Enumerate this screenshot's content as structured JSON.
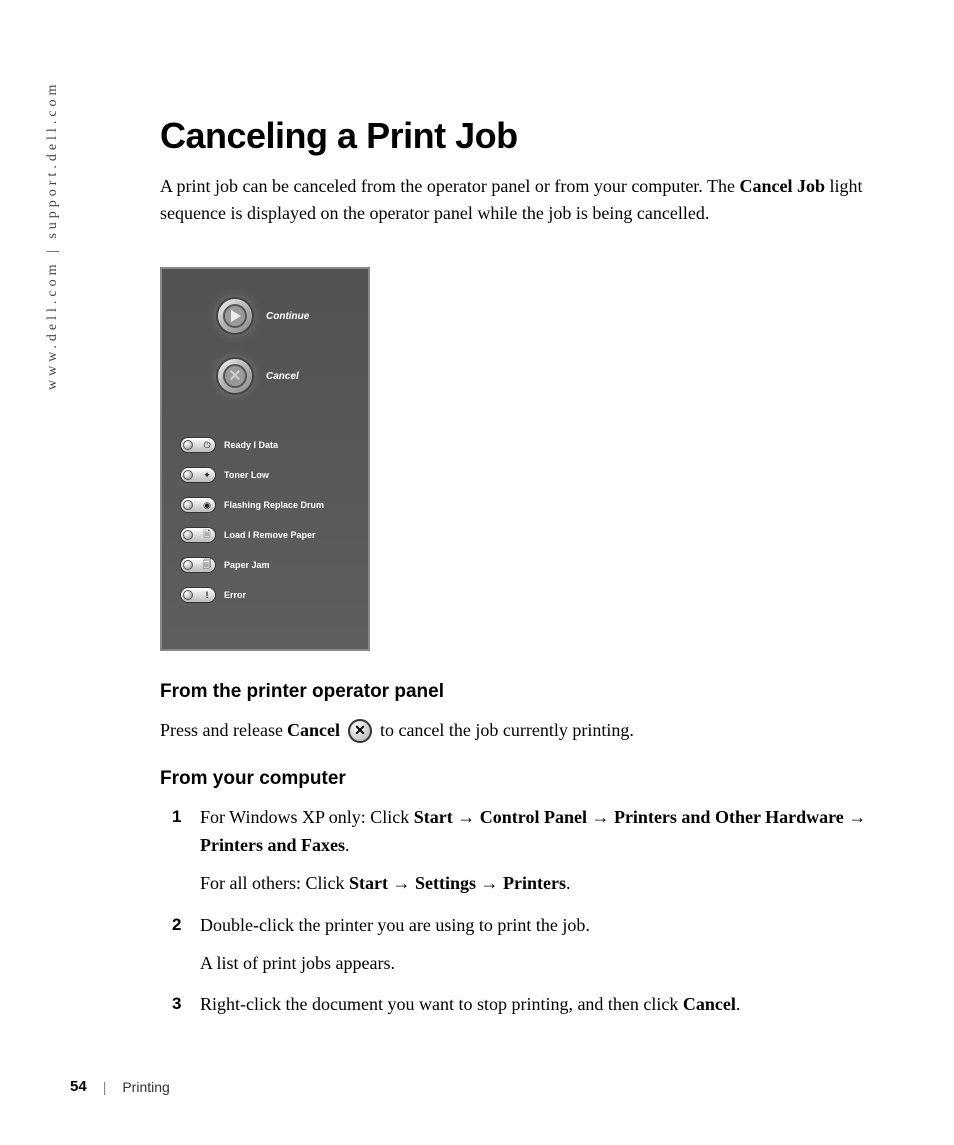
{
  "sidebar": {
    "text": "www.dell.com | support.dell.com"
  },
  "heading": "Canceling a Print Job",
  "intro": {
    "pre": "A print job can be canceled from the operator panel or from your computer. The ",
    "bold": "Cancel Job",
    "post": " light sequence is displayed on the operator panel while the job is being cancelled."
  },
  "panel": {
    "continue": "Continue",
    "cancel": "Cancel",
    "lights": [
      {
        "icon": "power",
        "label": "Ready I Data"
      },
      {
        "icon": "toner",
        "label": "Toner Low"
      },
      {
        "icon": "drum",
        "label": "Flashing Replace Drum"
      },
      {
        "icon": "paper",
        "label": "Load I Remove Paper"
      },
      {
        "icon": "jam",
        "label": "Paper Jam"
      },
      {
        "icon": "error",
        "label": "Error"
      }
    ]
  },
  "section1": {
    "title": "From the printer operator panel",
    "pre": "Press and release ",
    "bold": "Cancel",
    "post": " to cancel the job currently printing."
  },
  "section2": {
    "title": "From your computer",
    "steps": [
      {
        "line1_pre": "For Windows XP only: Click ",
        "line1_path": "Start → Control Panel → Printers and Other Hardware → Printers and Faxes",
        "line1_post": ".",
        "line2_pre": "For all others: Click ",
        "line2_path": "Start → Settings → Printers",
        "line2_post": "."
      },
      {
        "line1": "Double-click the printer you are using to print the job.",
        "line2": "A list of print jobs appears."
      },
      {
        "pre": "Right-click the document you want to stop printing, and then click ",
        "bold": "Cancel",
        "post": "."
      }
    ]
  },
  "footer": {
    "page": "54",
    "section": "Printing"
  }
}
